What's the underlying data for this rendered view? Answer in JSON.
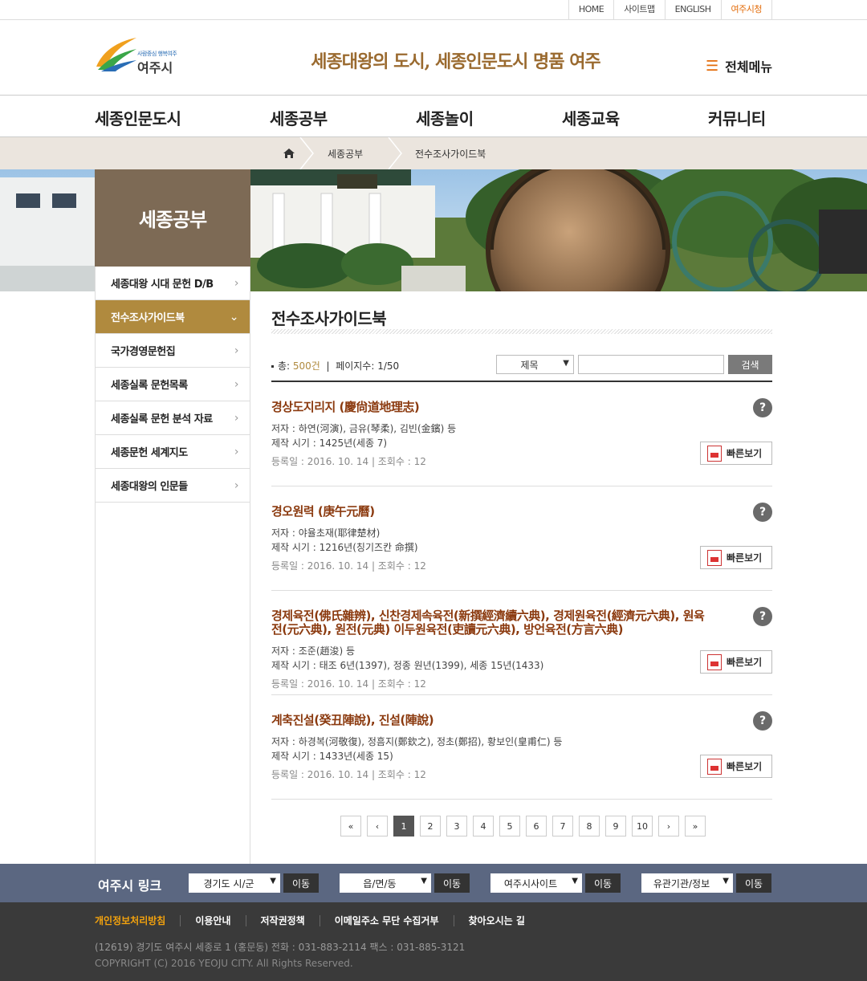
{
  "utility": {
    "home": "HOME",
    "sitemap": "사이트맵",
    "english": "ENGLISH",
    "cityhall": "여주시청"
  },
  "header": {
    "logo_slogan": "사람중심 행복여주",
    "logo_name": "여주시",
    "tagline": "세종대왕의 도시, 세종인문도시 명품 여주",
    "fullmenu_label": "전체메뉴",
    "fullmenu_icon": "hamburger-icon"
  },
  "gnb": [
    "세종인문도시",
    "세종공부",
    "세종놀이",
    "세종교육",
    "커뮤니티"
  ],
  "breadcrumb": {
    "home_icon": "home-icon",
    "level1": "세종공부",
    "level2": "전수조사가이드북"
  },
  "sidebar": {
    "title": "세종공부",
    "items": [
      {
        "label": "세종대왕 시대 문헌 D/B",
        "active": false
      },
      {
        "label": "전수조사가이드북",
        "active": true
      },
      {
        "label": "국가경영문헌집",
        "active": false
      },
      {
        "label": "세종실록 문헌목록",
        "active": false
      },
      {
        "label": "세종실록 문헌 분석 자료",
        "active": false
      },
      {
        "label": "세종문헌 세계지도",
        "active": false
      },
      {
        "label": "세종대왕의 인문들",
        "active": false
      }
    ]
  },
  "content": {
    "title": "전수조사가이드북",
    "total_prefix": "총: ",
    "total_count": "500건",
    "page_info": "페이지수: 1/50",
    "search": {
      "field_value": "제목",
      "button_label": "검색"
    },
    "entries": [
      {
        "title": "경상도지리지 (慶尙道地理志)",
        "author": "저자 : 하연(河演), 금유(琴柔), 김빈(金鑌) 등",
        "period": "제작 시기 : 1425년(세종 7)",
        "date": "등록일 : 2016. 10. 14   |   조회수 : 12",
        "quick": "빠른보기"
      },
      {
        "title": "경오원력 (庚午元曆)",
        "author": "저자 : 야율초재(耶律楚材)",
        "period": "제작 시기 : 1216년(칭기즈칸 命撰)",
        "date": "등록일 : 2016. 10. 14   |   조회수 : 12",
        "quick": "빠른보기"
      },
      {
        "title": "경제육전(佛氏雜辨), 신찬경제속육전(新撰經濟續六典), 경제원육전(經濟元六典), 원육전(元六典), 원전(元典) 이두원육전(吏讀元六典), 방언육전(方言六典)",
        "author": "저자 : 조준(趙浚) 등",
        "period": "제작 시기 : 태조 6년(1397), 정종 원년(1399), 세종 15년(1433)",
        "date": "등록일 : 2016. 10. 14   |   조회수 : 12",
        "quick": "빠른보기"
      },
      {
        "title": "계축진설(癸丑陣說), 진설(陣說)",
        "author": "저자 : 하경복(河敬復), 정흠지(鄭欽之), 정초(鄭招), 황보인(皇甫仁) 등",
        "period": "제작 시기 : 1433년(세종 15)",
        "date": "등록일 : 2016. 10. 14   |   조회수 : 12",
        "quick": "빠른보기"
      }
    ],
    "help_glyph": "?"
  },
  "pagination": {
    "first": "«",
    "prev": "‹",
    "pages": [
      "1",
      "2",
      "3",
      "4",
      "5",
      "6",
      "7",
      "8",
      "9",
      "10"
    ],
    "current": "1",
    "next": "›",
    "last": "»"
  },
  "links": {
    "title": "여주시 링크",
    "groups": [
      {
        "select": "경기도 시/군",
        "button": "이동"
      },
      {
        "select": "읍/면/동",
        "button": "이동"
      },
      {
        "select": "여주시사이트",
        "button": "이동"
      },
      {
        "select": "유관기관/정보",
        "button": "이동"
      }
    ]
  },
  "footer": {
    "menu": [
      "개인정보처리방침",
      "이용안내",
      "저작권정책",
      "이메일주소 무단 수집거부",
      "찾아오시는 길"
    ],
    "address": "(12619) 경기도 여주시 세종로 1 (홍문동)  전화 : 031-883-2114  팩스 : 031-885-3121",
    "copyright": "COPYRIGHT (C) 2016 YEOJU CITY. All Rights Reserved."
  },
  "colors": {
    "accent": "#b08a3e",
    "title_brown": "#8b3a0f",
    "tagline": "#9a6a2f",
    "orange": "#e36c0a",
    "linkbar": "#5b6781",
    "footer": "#3a3a3a"
  }
}
